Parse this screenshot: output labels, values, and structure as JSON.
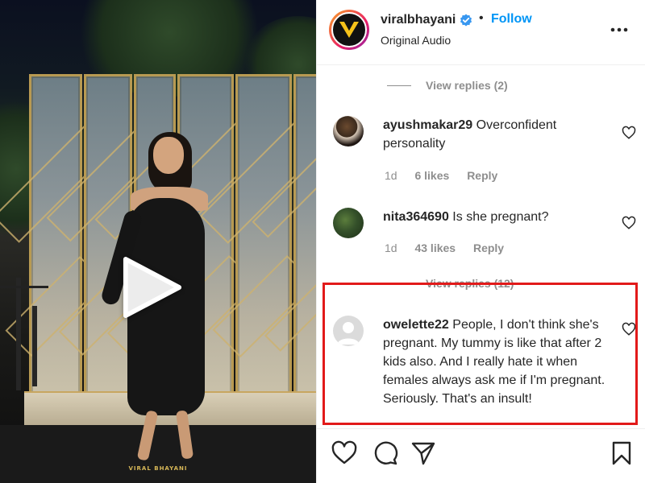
{
  "post": {
    "username": "viralbhayani",
    "separator": "•",
    "follow_label": "Follow",
    "audio_label": "Original Audio",
    "watermark": "VIRAL BHAYANI"
  },
  "comments_panel": {
    "view_replies_top": "View replies (2)",
    "view_replies_mid": "View replies (12)",
    "comments": [
      {
        "username": "ayushmakar29",
        "text": "Overconfident personality",
        "age": "1d",
        "likes": "6 likes",
        "reply": "Reply"
      },
      {
        "username": "nita364690",
        "text": "Is she pregnant?",
        "age": "1d",
        "likes": "43 likes",
        "reply": "Reply"
      },
      {
        "username": "owelette22",
        "text": "People, I don't think she's pregnant. My tummy is like that after 2 kids also. And I really hate it when females always ask me if I'm pregnant. Seriously. That's an insult!"
      }
    ]
  },
  "colors": {
    "follow": "#0095f6",
    "verified": "#3897f0",
    "highlight": "#e21a1a",
    "muted": "#8e8e8e"
  },
  "icons": {
    "play": "play-icon",
    "more": "more-options-icon",
    "like": "heart-icon",
    "comment": "comment-icon",
    "share": "share-icon",
    "save": "bookmark-icon"
  }
}
